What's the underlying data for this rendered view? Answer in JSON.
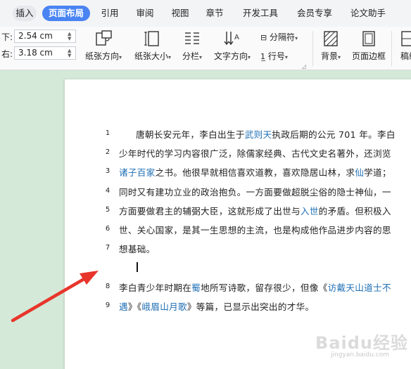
{
  "tabs": [
    {
      "label": "插入"
    },
    {
      "label": "页面布局"
    },
    {
      "label": "引用"
    },
    {
      "label": "审阅"
    },
    {
      "label": "视图"
    },
    {
      "label": "章节"
    },
    {
      "label": "开发工具"
    },
    {
      "label": "会员专享"
    },
    {
      "label": "论文助手"
    }
  ],
  "margins": {
    "bottom_label": "下:",
    "bottom_value": "2.54 cm",
    "right_label": "右:",
    "right_value": "3.18 cm"
  },
  "ribbon": {
    "orientation": "纸张方向",
    "size": "纸张大小",
    "columns": "分栏",
    "text_direction": "文字方向",
    "separator": "分隔符",
    "line_numbers": "行号",
    "background": "背景",
    "page_border": "页面边框",
    "cut_off": "稿纸"
  },
  "document": {
    "lines": [
      {
        "num": "1",
        "parts": [
          "唐朝长安元年，李白出生于",
          "武则天",
          "执政后期的公元 701 年。李白"
        ]
      },
      {
        "num": "2",
        "text": "少年时代的学习内容很广泛，除儒家经典、古代文史名著外，还浏览"
      },
      {
        "num": "3",
        "parts": [
          "诸子百家",
          "之书。他很早就相信喜欢道教，喜欢隐居山林，求",
          "仙",
          "学道；"
        ]
      },
      {
        "num": "4",
        "text": "同时又有建功立业的政治抱负。一方面要做超脱尘俗的隐士神仙，一"
      },
      {
        "num": "5",
        "parts": [
          "方面要做君主的辅弼大臣，这就形成了出世与",
          "入世",
          "的矛盾。但积极入"
        ]
      },
      {
        "num": "6",
        "text": "世、关心国家，是其一生思想的主流，也是构成他作品进步内容的思"
      },
      {
        "num": "7",
        "text": "想基础。"
      },
      {
        "num": "8",
        "parts": [
          "李白青少年时期在",
          "蜀",
          "地所写诗歌，留存很少，但像《",
          "访戴天山道士不"
        ]
      },
      {
        "num": "9",
        "parts": [
          "遇",
          "》《",
          "峨眉山月歌",
          "》等篇，已显示出突出的才华。"
        ]
      }
    ]
  },
  "watermark": {
    "text": "Baidu经验",
    "sub": "jingyan.baidu.com"
  },
  "colors": {
    "active_tab": "#4a84f3",
    "link_text": "#1f6fb5",
    "arrow": "#e8352b",
    "workspace": "#d4e9d8"
  }
}
